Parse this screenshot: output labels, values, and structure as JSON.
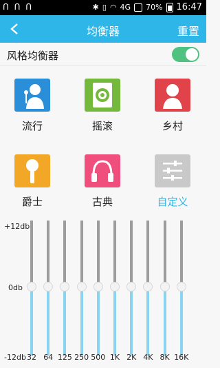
{
  "status": {
    "left_icons": "ꓵ ꓵ ꓵ",
    "network": "4G",
    "battery_percent": "70%",
    "time": "16:47"
  },
  "header": {
    "title": "均衡器",
    "reset_label": "重置"
  },
  "toggle": {
    "label": "风格均衡器",
    "on": true,
    "color": "#4fc27f"
  },
  "presets": [
    {
      "label": "流行",
      "icon": "singer-icon",
      "color": "#2a8fd8"
    },
    {
      "label": "摇滚",
      "icon": "speaker-icon",
      "color": "#74b93b"
    },
    {
      "label": "乡村",
      "icon": "woman-icon",
      "color": "#e0434a"
    },
    {
      "label": "爵士",
      "icon": "microphone-icon",
      "color": "#f2a826"
    },
    {
      "label": "古典",
      "icon": "headphones-icon",
      "color": "#f04f7e"
    },
    {
      "label": "自定义",
      "icon": "sliders-icon",
      "color": "#c9c9c9",
      "active": true
    }
  ],
  "equalizer": {
    "db_labels": {
      "top": "+12db",
      "mid": "0db",
      "bottom": "-12db"
    },
    "bands": [
      {
        "freq": "32",
        "gain_db": 0
      },
      {
        "freq": "64",
        "gain_db": 0
      },
      {
        "freq": "125",
        "gain_db": 0
      },
      {
        "freq": "250",
        "gain_db": 0
      },
      {
        "freq": "500",
        "gain_db": 0
      },
      {
        "freq": "1K",
        "gain_db": 0
      },
      {
        "freq": "2K",
        "gain_db": 0
      },
      {
        "freq": "4K",
        "gain_db": 0
      },
      {
        "freq": "8K",
        "gain_db": 0
      },
      {
        "freq": "16K",
        "gain_db": 0
      }
    ]
  },
  "accent": "#2eb6e8"
}
